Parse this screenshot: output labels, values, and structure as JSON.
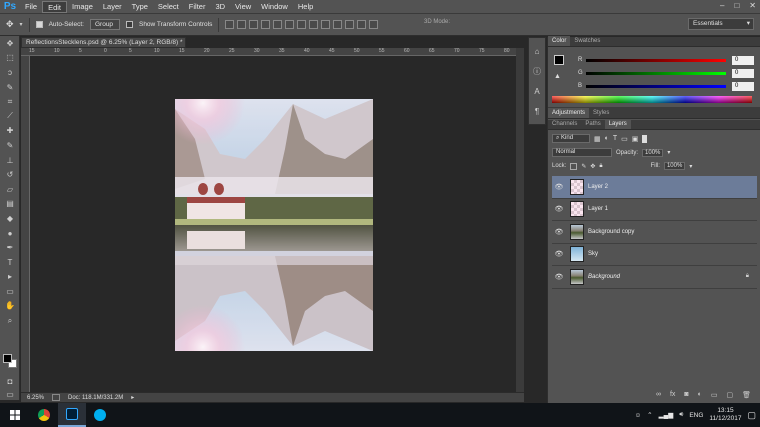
{
  "app": {
    "logo": "Ps"
  },
  "menu": [
    "File",
    "Edit",
    "Image",
    "Layer",
    "Type",
    "Select",
    "Filter",
    "3D",
    "View",
    "Window",
    "Help"
  ],
  "menu_active_index": 1,
  "window_controls": {
    "minimize": "–",
    "maximize": "□",
    "close": "✕"
  },
  "options_bar": {
    "auto_select_label": "Auto-Select:",
    "auto_select_value": "Group",
    "transform_label": "Show Transform Controls",
    "mode_3d_label": "3D Mode:",
    "workspace": "Essentials"
  },
  "document": {
    "tab_title": "ReflectionsStecklens.psd @ 6.25% (Layer 2, RGB/8) *",
    "ruler_ticks": [
      "15",
      "10",
      "5",
      "0",
      "5",
      "10",
      "15",
      "20",
      "25",
      "30",
      "35",
      "40",
      "45",
      "50",
      "55",
      "60",
      "65",
      "70",
      "75",
      "80"
    ],
    "zoom": "6.25%",
    "doc_size": "Doc: 118.1M/331.2M"
  },
  "color_panel": {
    "tabs": [
      "Color",
      "Swatches"
    ],
    "sliders": [
      {
        "label": "R",
        "value": "0",
        "color_from": "#000000",
        "color_to": "#ff0000"
      },
      {
        "label": "G",
        "value": "0",
        "color_from": "#000000",
        "color_to": "#00ff00"
      },
      {
        "label": "B",
        "value": "0",
        "color_from": "#000000",
        "color_to": "#0000ff"
      }
    ]
  },
  "adjustments_panel": {
    "tabs": [
      "Adjustments",
      "Styles"
    ]
  },
  "layers_panel": {
    "tabs": [
      "Channels",
      "Paths",
      "Layers"
    ],
    "filter_kind": "Kind",
    "blend_mode": "Normal",
    "opacity_label": "Opacity:",
    "opacity_value": "100%",
    "lock_label": "Lock:",
    "fill_label": "Fill:",
    "fill_value": "100%",
    "layers": [
      {
        "name": "Layer 2",
        "selected": true,
        "thumb": "checker-pink",
        "locked": false,
        "italic": false
      },
      {
        "name": "Layer 1",
        "selected": false,
        "thumb": "checker-pink",
        "locked": false,
        "italic": false
      },
      {
        "name": "Background copy",
        "selected": false,
        "thumb": "photo",
        "locked": false,
        "italic": false
      },
      {
        "name": "Sky",
        "selected": false,
        "thumb": "sky",
        "locked": false,
        "italic": false
      },
      {
        "name": "Background",
        "selected": false,
        "thumb": "photo",
        "locked": true,
        "italic": true
      }
    ]
  },
  "taskbar": {
    "apps": [
      {
        "name": "chrome-icon",
        "active": false
      },
      {
        "name": "photoshop-icon",
        "active": true
      },
      {
        "name": "skype-icon",
        "active": false
      }
    ],
    "language": "ENG",
    "time": "13:15",
    "date": "11/12/2017"
  }
}
